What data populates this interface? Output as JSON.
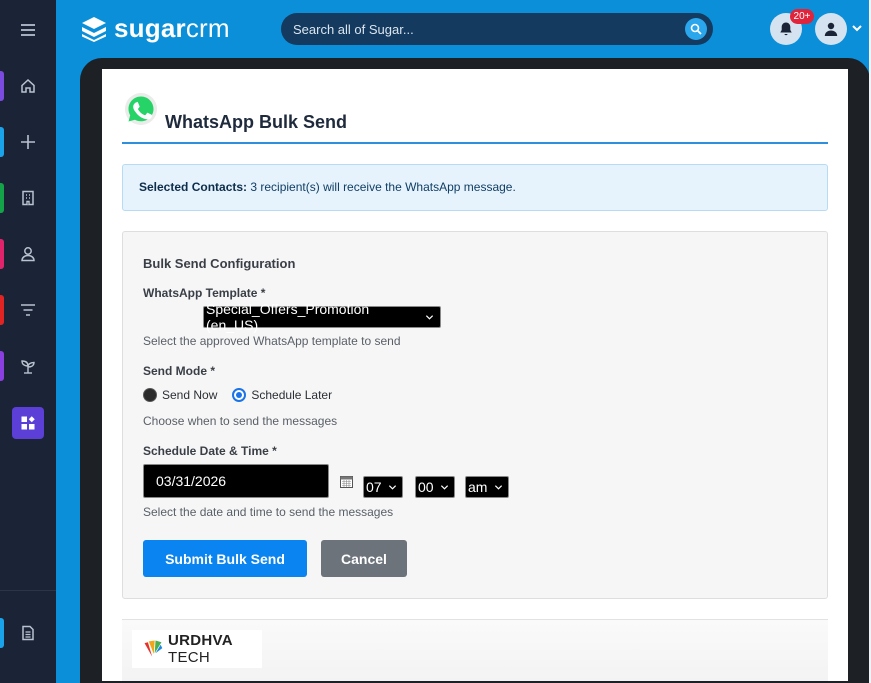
{
  "header": {
    "logo_bold": "sugar",
    "logo_thin": "crm",
    "search_placeholder": "Search all of Sugar...",
    "notification_count": "20+"
  },
  "sidebar": {
    "items": [
      {
        "name": "menu-icon",
        "mark_color": ""
      },
      {
        "name": "home-icon",
        "mark_color": "#7b4be0"
      },
      {
        "name": "plus-icon",
        "mark_color": "#1aa3e8"
      },
      {
        "name": "building-icon",
        "mark_color": "#15a34a"
      },
      {
        "name": "contact-icon",
        "mark_color": "#e0246b"
      },
      {
        "name": "filter-icon",
        "mark_color": "#e02424"
      },
      {
        "name": "sprout-icon",
        "mark_color": "#8b3fe0"
      },
      {
        "name": "dashboard-icon",
        "mark_color": ""
      },
      {
        "name": "document-icon",
        "mark_color": "#1aa3e8"
      }
    ]
  },
  "dialog": {
    "title": "WhatsApp Bulk Send",
    "info_label": "Selected Contacts:",
    "info_text": "3 recipient(s) will receive the WhatsApp message.",
    "config_title": "Bulk Send Configuration",
    "template_label": "WhatsApp Template *",
    "template_value": "Special_Offers_Promotion (en_US)",
    "template_help": "Select the approved WhatsApp template to send",
    "mode_label": "Send Mode *",
    "mode_send_now": "Send Now",
    "mode_schedule": "Schedule Later",
    "mode_help": "Choose when to send the messages",
    "schedule_label": "Schedule Date & Time *",
    "date_value": "03/31/2026",
    "hour_value": "07",
    "minute_value": "00",
    "ampm_value": "am",
    "schedule_help": "Select the date and time to send the messages",
    "submit_label": "Submit Bulk Send",
    "cancel_label": "Cancel"
  },
  "footer": {
    "brand_bold": "URDHVA",
    "brand_thin": " TECH"
  },
  "colors": {
    "header_blue": "#0c8fd9",
    "primary_button": "#0a84f0",
    "whatsapp_green": "#25d366"
  }
}
